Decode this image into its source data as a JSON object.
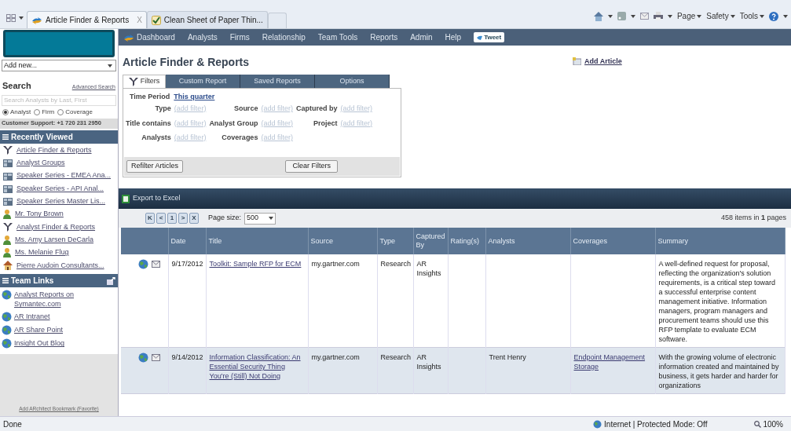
{
  "browser": {
    "tabs": [
      {
        "label": "Article Finder & Reports",
        "selected": true,
        "close": "X"
      },
      {
        "label": "Clean Sheet of Paper Thin...",
        "selected": false
      }
    ],
    "commands": [
      "Page",
      "Safety",
      "Tools"
    ]
  },
  "nav": {
    "items": [
      "Dashboard",
      "Analysts",
      "Firms",
      "Relationship",
      "Team Tools",
      "Reports",
      "Admin",
      "Help"
    ],
    "tweet": "Tweet"
  },
  "sidebar": {
    "add_new": "Add new...",
    "search_label": "Search",
    "advanced_search": "Advanced Search",
    "search_placeholder": "Search Analysts by Last, First",
    "radios": [
      {
        "label": "Analyst",
        "selected": true
      },
      {
        "label": "Firm",
        "selected": false
      },
      {
        "label": "Coverage",
        "selected": false
      }
    ],
    "support": "Customer Support: +1 720 231 2950",
    "recently_viewed": {
      "title": "Recently Viewed",
      "items": [
        {
          "label": "Article Finder & Reports",
          "kind": "filter"
        },
        {
          "label": "Analyst Groups",
          "kind": "group"
        },
        {
          "label": "Speaker Series - EMEA Ana...",
          "kind": "group"
        },
        {
          "label": "Speaker Series - API Anal...",
          "kind": "group"
        },
        {
          "label": "Speaker Series Master Lis...",
          "kind": "group"
        },
        {
          "label": "Mr. Tony Brown",
          "kind": "person"
        },
        {
          "label": "Analyst Finder & Reports",
          "kind": "filter"
        },
        {
          "label": "Ms. Amy Larsen DeCarla",
          "kind": "person"
        },
        {
          "label": "Ms. Melanie Flug",
          "kind": "person"
        },
        {
          "label": "Pierre Audoin Consultants...",
          "kind": "firm"
        }
      ]
    },
    "team_links": {
      "title": "Team Links",
      "items": [
        "Analyst Reports on Symantec.com",
        "AR Intranet",
        "AR Share Point",
        "Insight Out Blog"
      ]
    },
    "bookmark": "Add ARchitect Bookmark (Favorite)"
  },
  "main": {
    "title": "Article Finder & Reports",
    "add_article": "Add Article",
    "tabs": [
      {
        "label": "Filters",
        "selected": true
      },
      {
        "label": "Custom Report",
        "selected": false
      },
      {
        "label": "Saved Reports",
        "selected": false
      },
      {
        "label": "Options",
        "selected": false
      }
    ],
    "time_period": {
      "label": "Time Period",
      "value": "This quarter"
    },
    "filter_rows": [
      [
        {
          "label": "Type",
          "value": "(add filter)"
        },
        {
          "label": "Source",
          "value": "(add filter)"
        },
        {
          "label": "Captured by",
          "value": "(add filter)"
        }
      ],
      [
        {
          "label": "Title contains",
          "value": "(add filter)"
        },
        {
          "label": "Analyst Group",
          "value": "(add filter)"
        },
        {
          "label": "Project",
          "value": "(add filter)"
        }
      ],
      [
        {
          "label": "Analysts",
          "value": "(add filter)"
        },
        {
          "label": "Coverages",
          "value": "(add filter)"
        }
      ]
    ],
    "buttons": [
      "Refilter Articles",
      "Clear Filters"
    ],
    "export": "Export to Excel",
    "pager": {
      "first": "K",
      "prev": "<",
      "page": "1",
      "next": ">",
      "last": "X",
      "page_size_label": "Page size:",
      "page_size": "500",
      "summary": "458 items in **1** pages"
    },
    "table": {
      "columns": [
        "",
        "Date",
        "Title",
        "Source",
        "Type",
        "Captured By",
        "Rating(s)",
        "Analysts",
        "Coverages",
        "Summary"
      ],
      "rows": [
        {
          "highlighted": false,
          "date": "9/17/2012",
          "title": "Toolkit: Sample RFP for ECM",
          "source": "my.gartner.com",
          "type": "Research",
          "captured_by": "AR Insights",
          "ratings": "",
          "analysts": "",
          "coverages": [],
          "summary": "A well-defined request for proposal, reflecting the organization's solution requirements, is a critical step toward a successful enterprise content management initiative. Information managers, program managers and procurement teams should use this RFP template to evaluate ECM software."
        },
        {
          "highlighted": true,
          "date": "9/14/2012",
          "title": "Information Classification: An Essential Security Thing You're (Still) Not Doing",
          "source": "my.gartner.com",
          "type": "Research",
          "captured_by": "AR Insights",
          "ratings": "",
          "analysts": "Trent Henry",
          "coverages": [
            "Endpoint Management",
            "Storage"
          ],
          "summary": "With the growing volume of electronic information created and maintained by business, it gets harder and harder for organizations"
        }
      ]
    }
  },
  "status_bar": {
    "left": "Done",
    "zone": "Internet | Protected Mode: Off",
    "zoom": "100%"
  }
}
